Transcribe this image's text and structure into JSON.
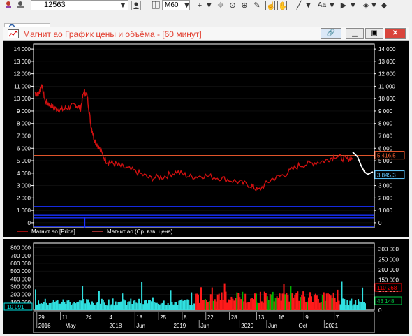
{
  "toolbar": {
    "ticker_value": "12563",
    "timeframe": "M60",
    "icons": [
      "app-icon",
      "ticker-dropdown-icon",
      "person-icon",
      "timeframe-dropdown-icon",
      "crosshair-icon",
      "move-icon",
      "target-icon",
      "zoom-in-icon",
      "pencil-icon",
      "hand-icon",
      "hand2-icon",
      "line-tool-icon",
      "text-tool-icon",
      "arrow-tool-icon",
      "eraser-icon"
    ],
    "text_tool_label": "Aa"
  },
  "search": {
    "icon": "search-icon"
  },
  "window": {
    "title": "Магнит ао График цены и объёма - [60 минут]",
    "colors": {
      "title": "#e23b2c",
      "close_bg": "#d9453c"
    }
  },
  "chart_data": [
    {
      "type": "line",
      "title": "",
      "ylim": [
        -400,
        14400
      ],
      "y_ticks": [
        14000,
        13000,
        12000,
        11000,
        10000,
        9000,
        8000,
        7000,
        6000,
        5000,
        4000,
        3000,
        2000,
        1000,
        0
      ],
      "y_tick_labels": [
        "14 000",
        "13 000",
        "12 000",
        "11 000",
        "10 000",
        "9 000",
        "8 000",
        "7 000",
        "6 000",
        "5 000",
        "4 000",
        "3 000",
        "2 000",
        "1 000",
        "0"
      ],
      "horizontal_lines": [
        {
          "value": 5416.5,
          "label": "5 416,5",
          "color": "#ff6030"
        },
        {
          "value": 3845.3,
          "label": "3 845,3",
          "color": "#60c8ff"
        }
      ],
      "series": [
        {
          "name": "Магнит ао [Price]",
          "color": "#d01010",
          "x_frac": [
            0,
            0.01,
            0.02,
            0.03,
            0.045,
            0.06,
            0.08,
            0.1,
            0.12,
            0.135,
            0.145,
            0.155,
            0.165,
            0.175,
            0.19,
            0.21,
            0.23,
            0.26,
            0.3,
            0.34,
            0.38,
            0.42,
            0.46,
            0.5,
            0.55,
            0.6,
            0.64,
            0.66,
            0.7,
            0.74,
            0.78,
            0.82,
            0.86,
            0.89,
            0.92,
            0.94
          ],
          "values": [
            10500,
            10300,
            11200,
            9800,
            9500,
            9200,
            9100,
            9300,
            9500,
            9200,
            10600,
            10200,
            8000,
            6800,
            6000,
            5000,
            4800,
            4500,
            4100,
            3600,
            3700,
            4100,
            3700,
            3800,
            3600,
            3300,
            3000,
            2600,
            3500,
            3900,
            4600,
            4800,
            5000,
            5400,
            5100,
            5200
          ]
        },
        {
          "name": "Магнит ао (Ср. взв. цена)",
          "color": "#d04040"
        }
      ],
      "forecast": {
        "color": "#ffffff",
        "x_frac": [
          0.94,
          0.955,
          0.965,
          0.975,
          0.985,
          1.0
        ],
        "values": [
          5700,
          5300,
          4600,
          4100,
          3900,
          4100
        ]
      }
    },
    {
      "type": "bar",
      "title": "",
      "ylim": [
        0,
        860000
      ],
      "y_ticks": [
        800000,
        700000,
        600000,
        500000,
        400000,
        300000,
        200000,
        100000
      ],
      "y_tick_labels": [
        "800 000",
        "700 000",
        "600 000",
        "500 000",
        "400 000",
        "300 000",
        "200 000",
        "100 000"
      ],
      "right_ticks": [
        300000,
        250000,
        200000,
        150000,
        100000,
        50000,
        0
      ],
      "right_tick_labels": [
        "300 000",
        "250 000",
        "200 000",
        "150 000",
        "100 000",
        "50 000",
        "0"
      ],
      "markers": [
        {
          "label": "10 091",
          "color": "#00e0e0",
          "side": "left"
        },
        {
          "label": "110 268",
          "color": "#ff0000",
          "side": "right"
        },
        {
          "label": "43 148",
          "color": "#00cc44",
          "side": "right"
        }
      ],
      "series_colors": {
        "volume_a": "#30e0e0",
        "volume_b": "#ff1a1a",
        "volume_c": "#00b000"
      }
    }
  ],
  "x_axis": {
    "day_labels": [
      "29",
      "11",
      "24",
      "4",
      "18",
      "25",
      "8",
      "22",
      "28",
      "13",
      "16",
      "9",
      "7"
    ],
    "period_labels": [
      "2016",
      "May",
      "2018",
      "Jun",
      "2019",
      "Jun",
      "2020",
      "Jun",
      "Oct",
      "2021"
    ]
  }
}
